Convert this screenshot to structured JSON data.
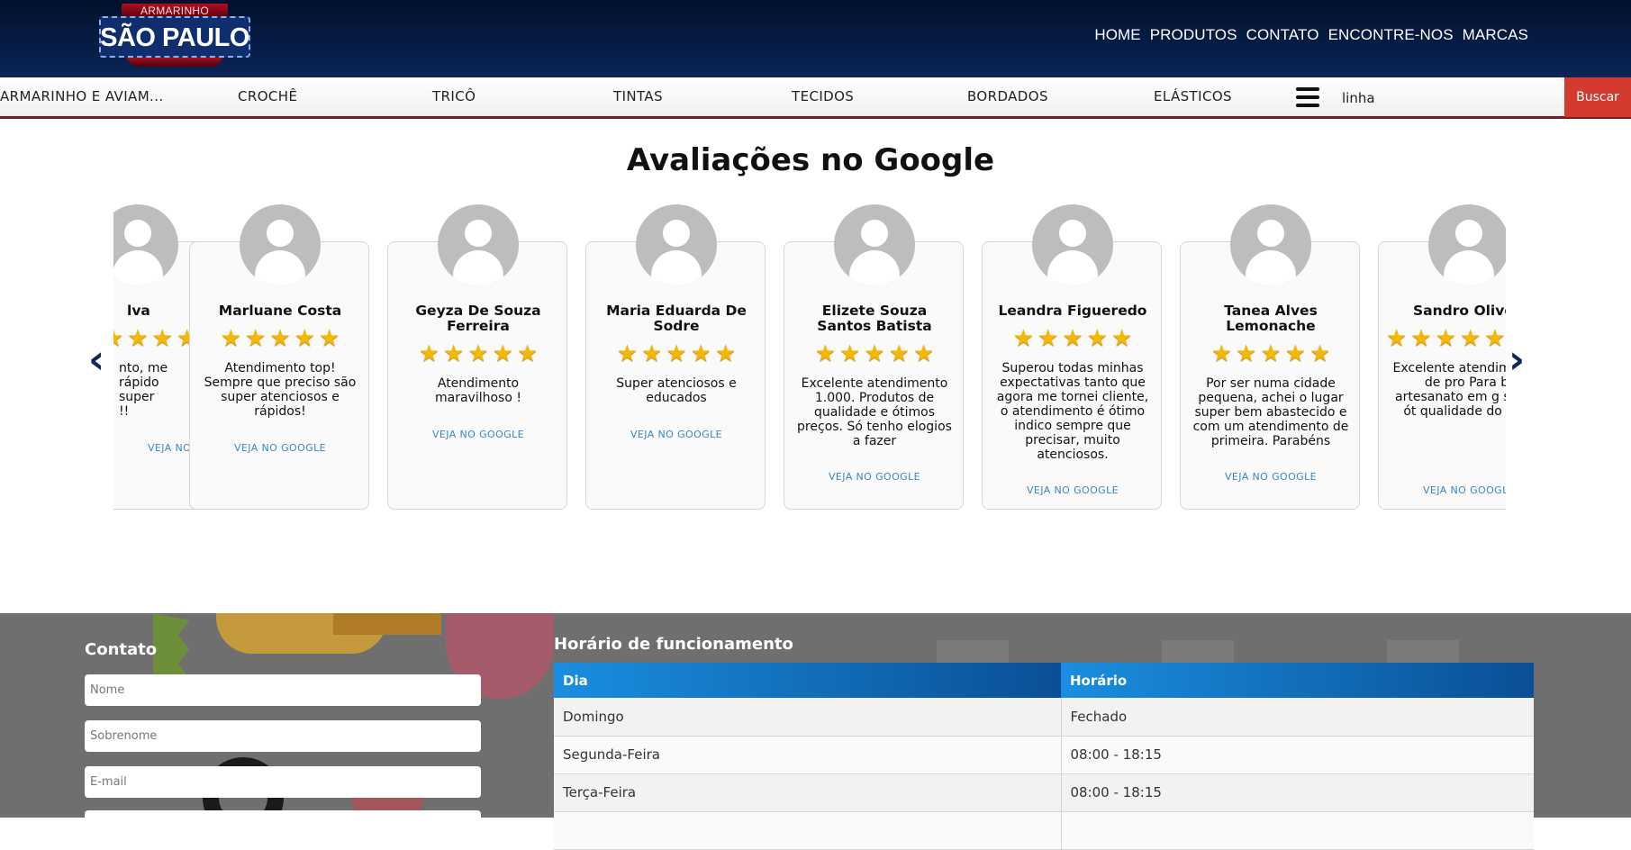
{
  "header": {
    "logo_top": "ARMARINHO",
    "logo_main": "SÃO PAULO",
    "nav": [
      "HOME",
      "PRODUTOS",
      "CONTATO",
      "ENCONTRE-NOS",
      "MARCAS"
    ]
  },
  "categories": [
    "ARMARINHO E AVIAM...",
    "CROCHÊ",
    "TRICÔ",
    "TINTAS",
    "TECIDOS",
    "BORDADOS",
    "ELÁSTICOS"
  ],
  "search": {
    "value": "linha",
    "button": "Buscar",
    "menu_icon": "hamburger-menu-icon"
  },
  "reviews": {
    "title": "Avaliações no Google",
    "link_label": "VEJA NO GOOGLE",
    "items": [
      {
        "name": "lva",
        "rating": 5,
        "text": "nto, me\nrápido\nsuper\n!!"
      },
      {
        "name": "Marluane Costa",
        "rating": 5,
        "text": "Atendimento top! Sempre que preciso são super atenciosos e rápidos!"
      },
      {
        "name": "Geyza De Souza Ferreira",
        "rating": 5,
        "text": "Atendimento maravilhoso !"
      },
      {
        "name": "Maria Eduarda De Sodre",
        "rating": 5,
        "text": "Super atenciosos e educados"
      },
      {
        "name": "Elizete Souza Santos Batista",
        "rating": 5,
        "text": "Excelente atendimento 1.000. Produtos de qualidade e ótimos preços. Só tenho elogios a fazer"
      },
      {
        "name": "Leandra Figueredo",
        "rating": 5,
        "text": "Superou todas minhas expectativas tanto que agora me tornei cliente, o atendimento é ótimo indico sempre que precisar, muito atenciosos."
      },
      {
        "name": "Tanea Alves Lemonache",
        "rating": 5,
        "text": "Por ser numa cidade pequena, achei o lugar super bem abastecido e com um atendimento de primeira. Parabéns"
      },
      {
        "name": "Sandro Olive",
        "rating": 5,
        "text": "Excelente atendim variedades de pro Para bordado artesanato em g sem falar na ót qualidade do produtos..."
      }
    ],
    "prev_icon": "chevron-left-icon",
    "next_icon": "chevron-right-icon"
  },
  "contact": {
    "title": "Contato",
    "placeholders": [
      "Nome",
      "Sobrenome",
      "E-mail"
    ]
  },
  "hours": {
    "title": "Horário de funcionamento",
    "headers": [
      "Dia",
      "Horário"
    ],
    "rows": [
      [
        "Domingo",
        "Fechado"
      ],
      [
        "Segunda-Feira",
        "08:00 - 18:15"
      ],
      [
        "Terça-Feira",
        "08:00 - 18:15"
      ],
      [
        "",
        ""
      ]
    ]
  },
  "colors": {
    "header_dark": "#02102b",
    "header_blue": "#0a2558",
    "accent_red": "#d33b2e",
    "star": "#f6b704",
    "link": "#3a86c4",
    "table_blue": "#1a8ee0"
  }
}
